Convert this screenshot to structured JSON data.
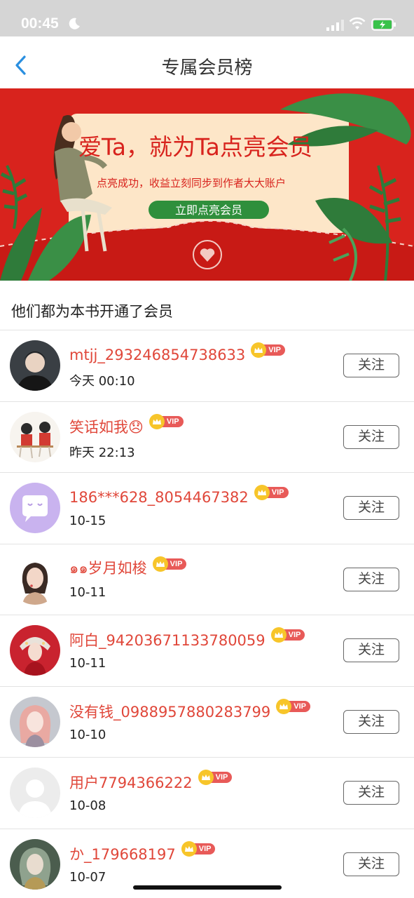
{
  "status_bar": {
    "time": "00:45"
  },
  "nav": {
    "title": "专属会员榜"
  },
  "banner": {
    "headline": "爱Ta，就为Ta点亮会员",
    "subline": "点亮成功，收益立刻同步到作者大大账户",
    "cta": "立即点亮会员"
  },
  "section": {
    "title": "他们都为本书开通了会员"
  },
  "members": [
    {
      "name": "mtjj_293246854738633",
      "time": "今天 00:10",
      "vip": "VIP",
      "follow": "关注"
    },
    {
      "name": "笑话如我😞",
      "time": "昨天 22:13",
      "vip": "VIP",
      "follow": "关注"
    },
    {
      "name": "186***628_8054467382",
      "time": "10-15",
      "vip": "VIP",
      "follow": "关注"
    },
    {
      "name": "๑๑岁月如梭",
      "time": "10-11",
      "vip": "VIP",
      "follow": "关注"
    },
    {
      "name": "阿白_94203671133780059",
      "time": "10-11",
      "vip": "VIP",
      "follow": "关注"
    },
    {
      "name": "没有钱_0988957880283799",
      "time": "10-10",
      "vip": "VIP",
      "follow": "关注"
    },
    {
      "name": "用户7794366222",
      "time": "10-08",
      "vip": "VIP",
      "follow": "关注"
    },
    {
      "name": "か_179668197",
      "time": "10-07",
      "vip": "VIP",
      "follow": "关注"
    }
  ],
  "colors": {
    "accent": "#e0473a",
    "banner_red": "#d8231d",
    "back_arrow": "#2a8fe0",
    "vip_badge": "#e85a58"
  }
}
